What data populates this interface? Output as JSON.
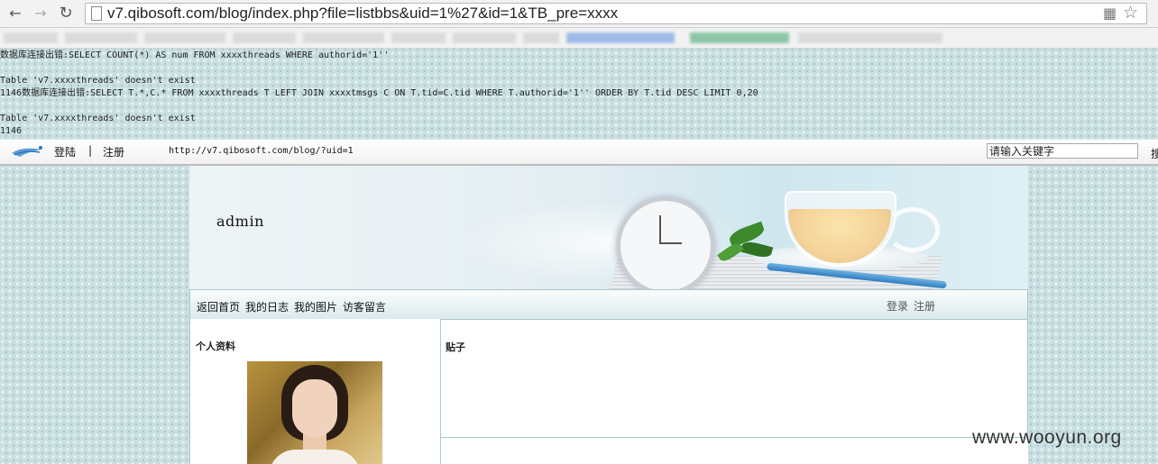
{
  "browser": {
    "url": "v7.qibosoft.com/blog/index.php?file=listbbs&uid=1%27&id=1&TB_pre=xxxx"
  },
  "errors": {
    "lines": [
      "数据库连接出错:SELECT COUNT(*) AS num FROM xxxxthreads WHERE authorid='1''",
      "",
      "Table 'v7.xxxxthreads' doesn't exist",
      "1146数据库连接出错:SELECT T.*,C.* FROM xxxxthreads T LEFT JOIN xxxxtmsgs C ON T.tid=C.tid WHERE T.authorid='1'' ORDER BY T.tid DESC LIMIT 0,20",
      "",
      "Table 'v7.xxxxthreads' doesn't exist",
      "1146"
    ]
  },
  "topbar": {
    "login": "登陆",
    "separator": "|",
    "register": "注册",
    "url": "http://v7.qibosoft.com/blog/?uid=1",
    "search_value": "请输入关键字",
    "search_button": "搜"
  },
  "banner": {
    "username": "admin"
  },
  "nav": {
    "items": [
      "返回首页",
      "我的日志",
      "我的图片",
      "访客留言"
    ],
    "login": "登录",
    "register": "注册"
  },
  "profile": {
    "title": "个人资料"
  },
  "posts": {
    "title": "贴子"
  },
  "watermark": "www.wooyun.org"
}
